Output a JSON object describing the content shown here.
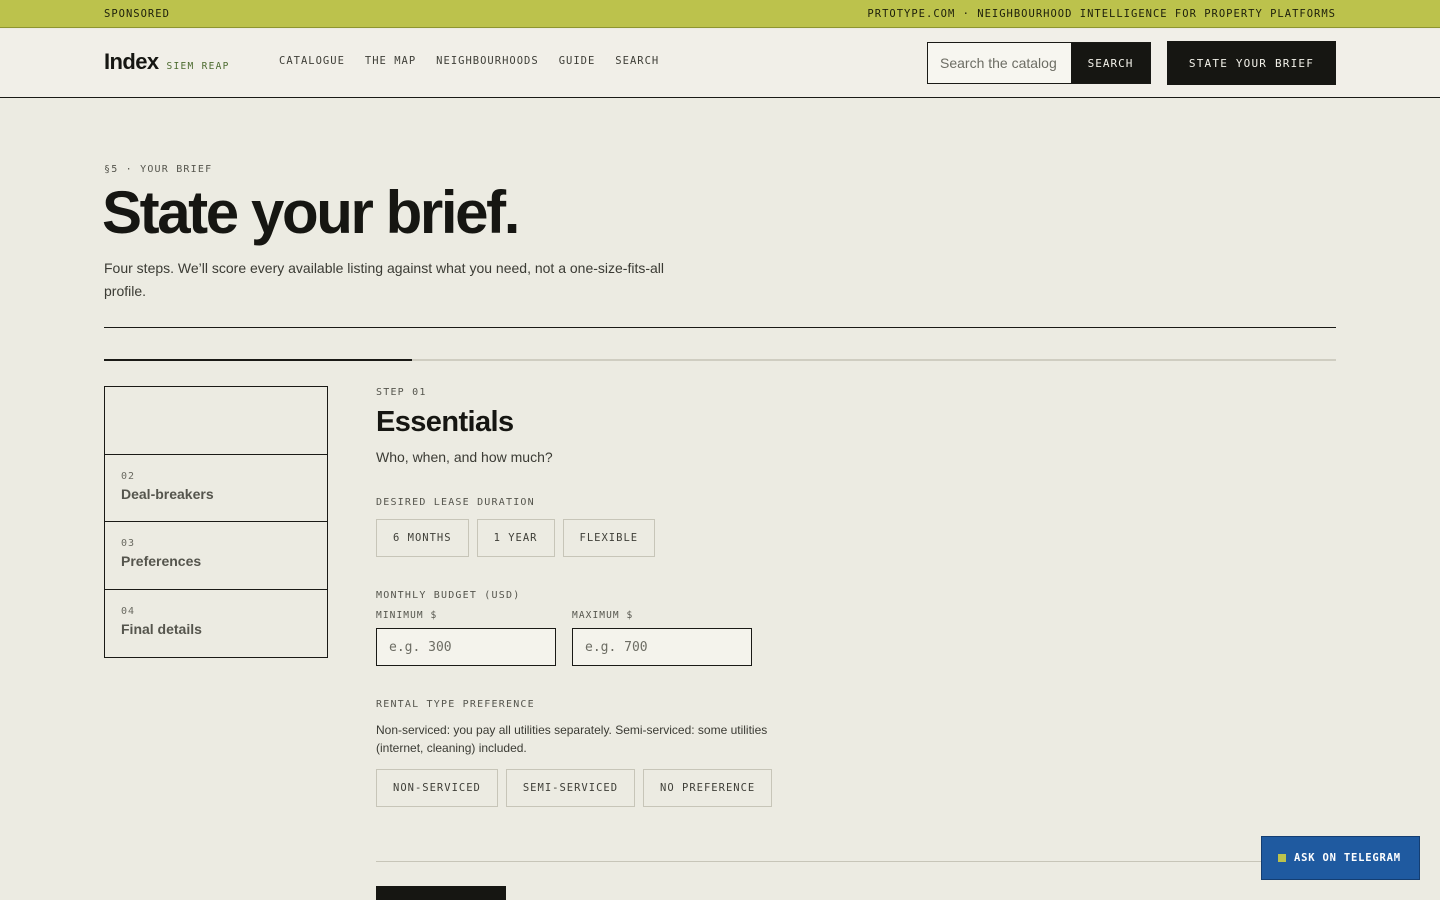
{
  "sponsor_bar": {
    "label": "SPONSORED",
    "tagline": "PRTOTYPE.COM · NEIGHBOURHOOD INTELLIGENCE FOR PROPERTY PLATFORMS"
  },
  "header": {
    "logo_word": "Index",
    "logo_city": "SIEM REAP",
    "nav": [
      "CATALOGUE",
      "THE MAP",
      "NEIGHBOURHOODS",
      "GUIDE",
      "SEARCH"
    ],
    "search_placeholder": "Search the catalog",
    "search_button": "SEARCH",
    "brief_button": "STATE YOUR BRIEF"
  },
  "hero": {
    "eyebrow": "§5 · YOUR BRIEF",
    "title": "State your brief.",
    "lede": "Four steps. We’ll score every available listing against what you need, not a one-size-fits-all profile."
  },
  "progress": {
    "fraction": 0.25
  },
  "steps": [
    {
      "num": "",
      "label": ""
    },
    {
      "num": "02",
      "label": "Deal-breakers"
    },
    {
      "num": "03",
      "label": "Preferences"
    },
    {
      "num": "04",
      "label": "Final details"
    }
  ],
  "form": {
    "step_eyebrow": "STEP 01",
    "step_title": "Essentials",
    "step_subtitle": "Who, when, and how much?",
    "lease": {
      "label": "DESIRED LEASE DURATION",
      "options": [
        "6 MONTHS",
        "1 YEAR",
        "FLEXIBLE"
      ]
    },
    "budget": {
      "label": "MONTHLY BUDGET (USD)",
      "min_label": "MINIMUM $",
      "min_placeholder": "e.g. 300",
      "max_label": "MAXIMUM $",
      "max_placeholder": "e.g. 700"
    },
    "rental_type": {
      "label": "RENTAL TYPE PREFERENCE",
      "help": "Non-serviced: you pay all utilities separately. Semi-serviced: some utilities (internet, cleaning) included.",
      "options": [
        "NON-SERVICED",
        "SEMI-SERVICED",
        "NO PREFERENCE"
      ]
    }
  },
  "telegram": {
    "label": "ASK ON TELEGRAM"
  },
  "colors": {
    "background": "#ecebe2",
    "sponsor": "#bcc24c",
    "ink": "#161612",
    "telegram": "#1f5aa0"
  }
}
